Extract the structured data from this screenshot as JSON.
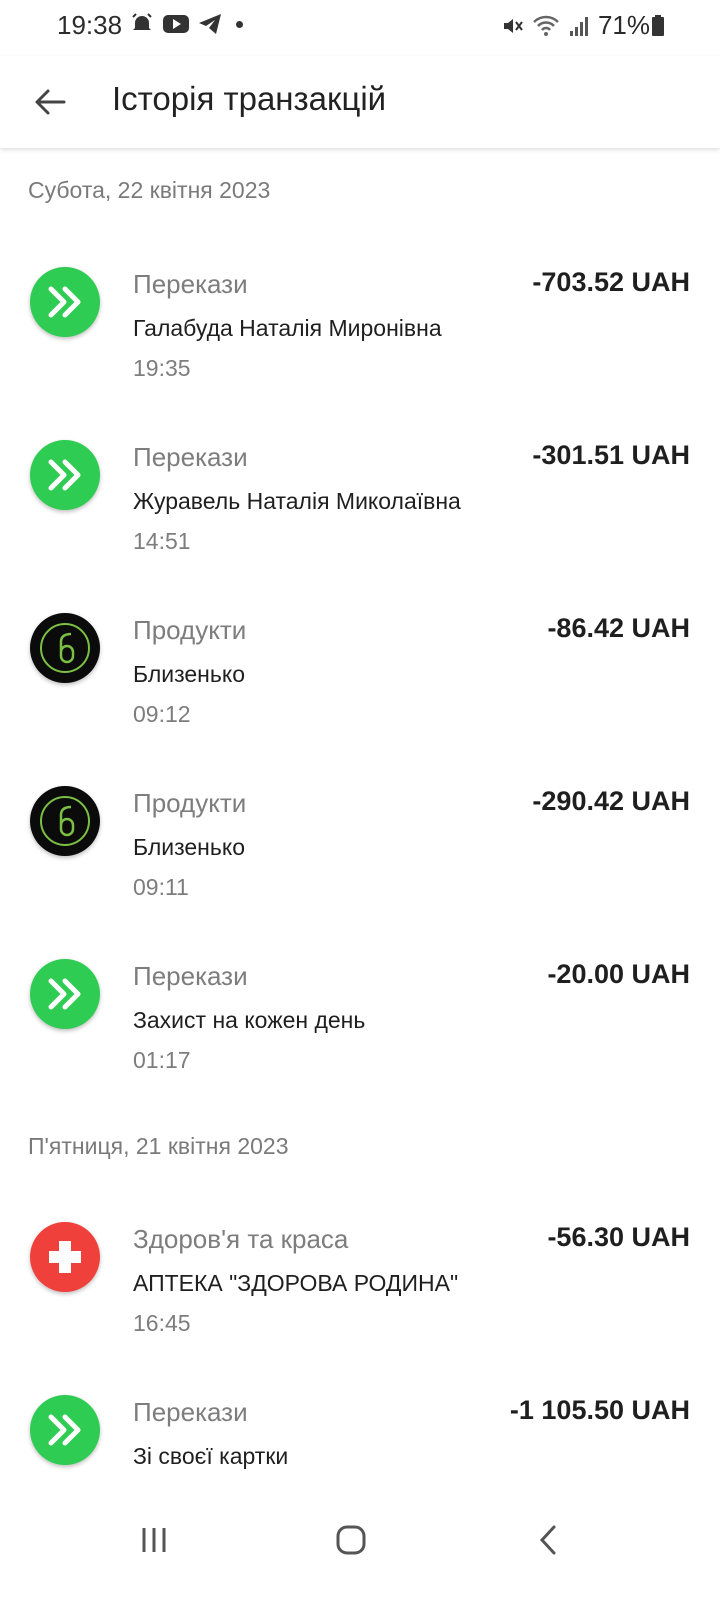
{
  "status_bar": {
    "time": "19:38",
    "battery": "71%",
    "icons_left": [
      "alarm-icon",
      "youtube-icon",
      "telegram-icon"
    ],
    "icons_right": [
      "mute-icon",
      "wifi-icon",
      "signal-icon",
      "battery-icon"
    ]
  },
  "header": {
    "title": "Історія транзакцій"
  },
  "sections": [
    {
      "date": "Субота, 22 квітня 2023",
      "items": [
        {
          "category": "Перекази",
          "name": "Галабуда Наталія Миронівна",
          "time": "19:35",
          "amount": "-703.52 UAH",
          "icon": "transfer-icon"
        },
        {
          "category": "Перекази",
          "name": "Журавель Наталія Миколаївна",
          "time": "14:51",
          "amount": "-301.51 UAH",
          "icon": "transfer-icon"
        },
        {
          "category": "Продукти",
          "name": "Близенько",
          "time": "09:12",
          "amount": "-86.42 UAH",
          "icon": "blyzenko-logo-icon"
        },
        {
          "category": "Продукти",
          "name": "Близенько",
          "time": "09:11",
          "amount": "-290.42 UAH",
          "icon": "blyzenko-logo-icon"
        },
        {
          "category": "Перекази",
          "name": "Захист на кожен день",
          "time": "01:17",
          "amount": "-20.00 UAH",
          "icon": "transfer-icon"
        }
      ]
    },
    {
      "date": "П'ятниця, 21 квітня 2023",
      "items": [
        {
          "category": "Здоров'я та краса",
          "name": "АПТЕКА \"ЗДОРОВА РОДИНА\"",
          "time": "16:45",
          "amount": "-56.30 UAH",
          "icon": "medical-cross-icon"
        },
        {
          "category": "Перекази",
          "name": "Зі своєї картки",
          "time": "",
          "amount": "-1 105.50 UAH",
          "icon": "transfer-icon"
        }
      ]
    }
  ],
  "colors": {
    "transfer": "#2ecc52",
    "grocery": "#0b0b0b",
    "health": "#f0403b"
  }
}
